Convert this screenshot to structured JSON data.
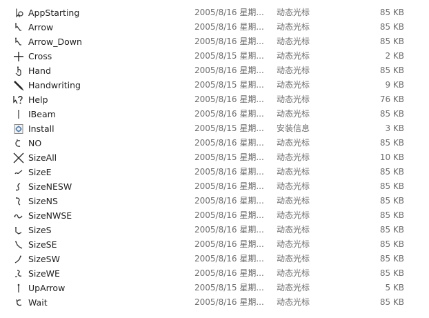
{
  "files": [
    {
      "name": "AppStarting",
      "date": "2005/8/16 星期...",
      "type": "动态光标",
      "size": "85 KB",
      "icon": "cursor-busy-icon"
    },
    {
      "name": "Arrow",
      "date": "2005/8/16 星期...",
      "type": "动态光标",
      "size": "85 KB",
      "icon": "cursor-arrow-icon"
    },
    {
      "name": "Arrow_Down",
      "date": "2005/8/16 星期...",
      "type": "动态光标",
      "size": "85 KB",
      "icon": "cursor-arrow-down-icon"
    },
    {
      "name": "Cross",
      "date": "2005/8/15 星期...",
      "type": "动态光标",
      "size": "2 KB",
      "icon": "cursor-cross-icon"
    },
    {
      "name": "Hand",
      "date": "2005/8/16 星期...",
      "type": "动态光标",
      "size": "85 KB",
      "icon": "cursor-hand-icon"
    },
    {
      "name": "Handwriting",
      "date": "2005/8/15 星期...",
      "type": "动态光标",
      "size": "9 KB",
      "icon": "cursor-pen-icon"
    },
    {
      "name": "Help",
      "date": "2005/8/16 星期...",
      "type": "动态光标",
      "size": "76 KB",
      "icon": "cursor-help-icon"
    },
    {
      "name": "IBeam",
      "date": "2005/8/16 星期...",
      "type": "动态光标",
      "size": "85 KB",
      "icon": "cursor-ibeam-icon"
    },
    {
      "name": "Install",
      "date": "2005/8/15 星期...",
      "type": "安装信息",
      "size": "3 KB",
      "icon": "install-info-file-icon"
    },
    {
      "name": "NO",
      "date": "2005/8/16 星期...",
      "type": "动态光标",
      "size": "85 KB",
      "icon": "cursor-no-icon"
    },
    {
      "name": "SizeAll",
      "date": "2005/8/15 星期...",
      "type": "动态光标",
      "size": "10 KB",
      "icon": "cursor-move-icon"
    },
    {
      "name": "SizeE",
      "date": "2005/8/16 星期...",
      "type": "动态光标",
      "size": "85 KB",
      "icon": "cursor-size-e-icon"
    },
    {
      "name": "SizeNESW",
      "date": "2005/8/16 星期...",
      "type": "动态光标",
      "size": "85 KB",
      "icon": "cursor-size-nesw-icon"
    },
    {
      "name": "SizeNS",
      "date": "2005/8/16 星期...",
      "type": "动态光标",
      "size": "85 KB",
      "icon": "cursor-size-ns-icon"
    },
    {
      "name": "SizeNWSE",
      "date": "2005/8/16 星期...",
      "type": "动态光标",
      "size": "85 KB",
      "icon": "cursor-size-nwse-icon"
    },
    {
      "name": "SizeS",
      "date": "2005/8/16 星期...",
      "type": "动态光标",
      "size": "85 KB",
      "icon": "cursor-size-s-icon"
    },
    {
      "name": "SizeSE",
      "date": "2005/8/16 星期...",
      "type": "动态光标",
      "size": "85 KB",
      "icon": "cursor-size-se-icon"
    },
    {
      "name": "SizeSW",
      "date": "2005/8/16 星期...",
      "type": "动态光标",
      "size": "85 KB",
      "icon": "cursor-size-sw-icon"
    },
    {
      "name": "SizeWE",
      "date": "2005/8/16 星期...",
      "type": "动态光标",
      "size": "85 KB",
      "icon": "cursor-size-we-icon"
    },
    {
      "name": "UpArrow",
      "date": "2005/8/15 星期...",
      "type": "动态光标",
      "size": "5 KB",
      "icon": "cursor-up-arrow-icon"
    },
    {
      "name": "Wait",
      "date": "2005/8/16 星期...",
      "type": "动态光标",
      "size": "85 KB",
      "icon": "cursor-wait-icon"
    }
  ]
}
